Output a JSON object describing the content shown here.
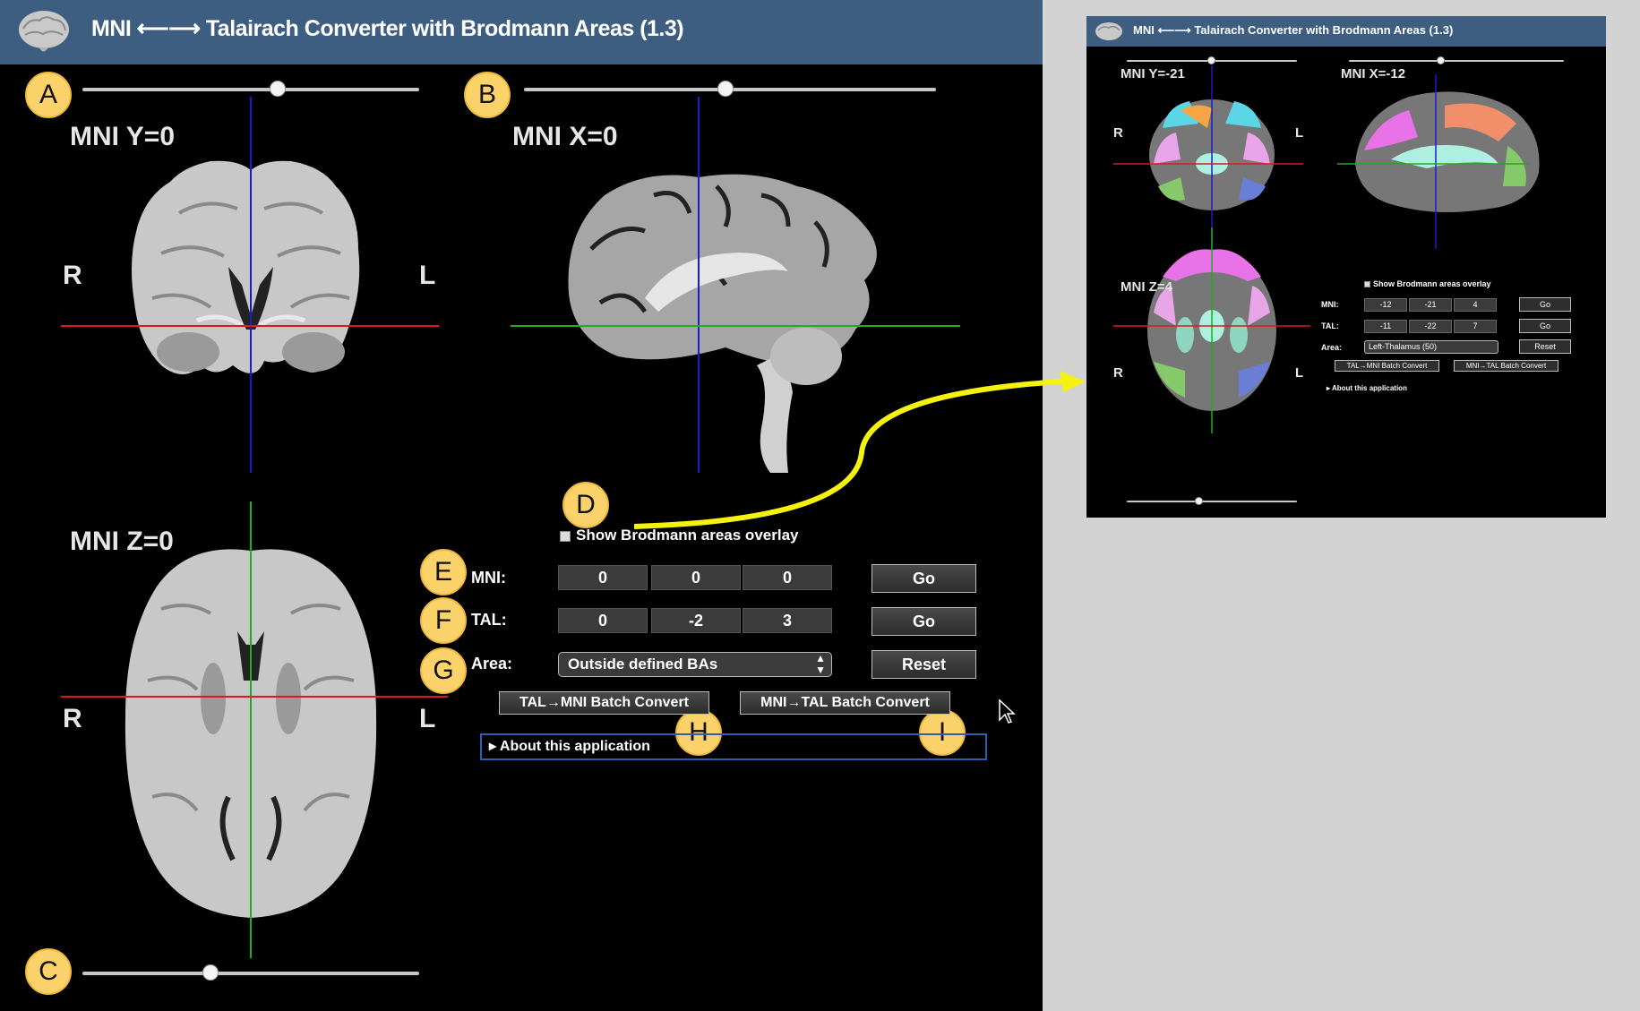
{
  "app": {
    "title": "MNI ⟵⟶ Talairach Converter with Brodmann Areas (1.3)",
    "views": {
      "coronal": {
        "label": "MNI Y=0",
        "left": "R",
        "right": "L"
      },
      "sagittal": {
        "label": "MNI X=0"
      },
      "axial": {
        "label": "MNI Z=0",
        "left": "R",
        "right": "L"
      }
    },
    "sliders": {
      "coronal_value": 0.58,
      "sagittal_value": 0.49,
      "axial_value": 0.38
    },
    "overlay_checkbox": {
      "label": "Show Brodmann areas overlay",
      "checked": false
    },
    "mni": {
      "label": "MNI:",
      "x": "0",
      "y": "0",
      "z": "0",
      "go": "Go"
    },
    "tal": {
      "label": "TAL:",
      "x": "0",
      "y": "-2",
      "z": "3",
      "go": "Go"
    },
    "area": {
      "label": "Area:",
      "selected": "Outside defined BAs",
      "reset": "Reset"
    },
    "batch": {
      "tal_to_mni": "TAL→MNI Batch Convert",
      "mni_to_tal": "MNI→TAL Batch Convert"
    },
    "about": "About this application"
  },
  "annotations": {
    "a": "A",
    "b": "B",
    "c": "C",
    "d": "D",
    "e": "E",
    "f": "F",
    "g": "G",
    "h": "H",
    "i": "I"
  },
  "preview": {
    "title": "MNI ⟵⟶ Talairach Converter with Brodmann Areas (1.3)",
    "coronal_label": "MNI Y=-21",
    "sagittal_label": "MNI X=-12",
    "axial_label": "MNI Z=4",
    "r": "R",
    "l": "L",
    "overlay_label": "Show Brodmann areas overlay",
    "mni": {
      "label": "MNI:",
      "x": "-12",
      "y": "-21",
      "z": "4",
      "go": "Go"
    },
    "tal": {
      "label": "TAL:",
      "x": "-11",
      "y": "-22",
      "z": "7",
      "go": "Go"
    },
    "area": {
      "label": "Area:",
      "selected": "Left-Thalamus (50)",
      "reset": "Reset"
    },
    "batch": {
      "tal_to_mni": "TAL→MNI Batch Convert",
      "mni_to_tal": "MNI→TAL Batch Convert"
    },
    "about": "About this application"
  },
  "colors": {
    "titlebar": "#3d5e80",
    "badge": "#fcd36a",
    "crosshair_red": "#e01818",
    "crosshair_blue": "#1c1ccc",
    "crosshair_green": "#1fae1f",
    "arrow": "#f4f20e"
  }
}
